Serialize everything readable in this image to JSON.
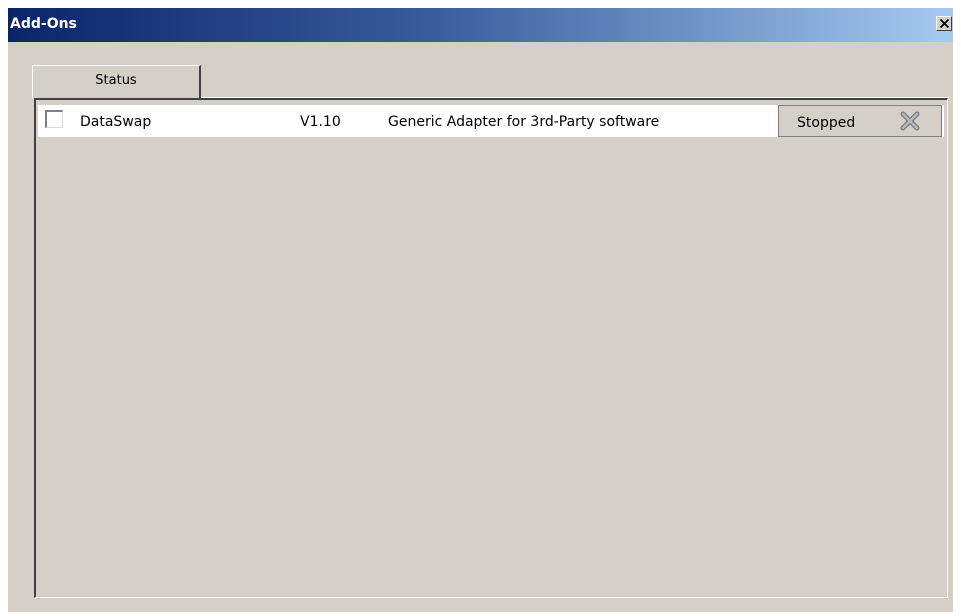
{
  "window": {
    "title": "Add-Ons",
    "close_icon": "close-x-icon"
  },
  "tabs": [
    {
      "label": "Status",
      "active": true
    }
  ],
  "addons": [
    {
      "name": "DataSwap",
      "checked": false,
      "version": "V1.10",
      "description": "Generic Adapter for 3rd-Party software",
      "status": "Stopped",
      "action_icon": "remove-x-icon"
    }
  ],
  "colors": {
    "title_gradient_start": "#0a246a",
    "title_gradient_end": "#a6caf0",
    "face": "#d4d0c8",
    "row_bg": "#ffffff"
  }
}
